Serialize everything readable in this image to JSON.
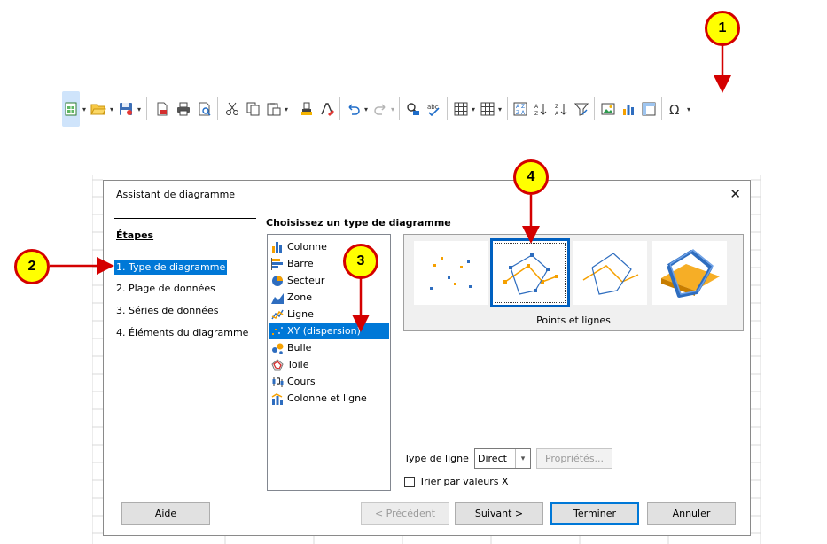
{
  "annotations": {
    "b1": "1",
    "b2": "2",
    "b3": "3",
    "b4": "4"
  },
  "toolbar": {
    "icons": [
      "new-spreadsheet-icon",
      "open-folder-icon",
      "save-icon",
      "export-pdf-icon",
      "print-icon",
      "print-preview-icon",
      "cut-icon",
      "copy-icon",
      "paste-icon",
      "clone-formatting-icon",
      "clear-formatting-icon",
      "undo-icon",
      "redo-icon",
      "find-replace-icon",
      "spelling-icon",
      "row-icon",
      "column-icon",
      "sort-icon",
      "sort-ascending-icon",
      "sort-descending-icon",
      "autofilter-icon",
      "insert-image-icon",
      "insert-chart-icon",
      "pivot-table-icon",
      "special-character-icon"
    ],
    "accent": "#1a73c8",
    "chart_icon_color": "#2e6dbf"
  },
  "dialog": {
    "title": "Assistant de diagramme",
    "close_glyph": "✕",
    "steps_heading": "Étapes",
    "steps": [
      {
        "label": "1. Type de diagramme",
        "active": true
      },
      {
        "label": "2. Plage de données",
        "active": false
      },
      {
        "label": "3. Séries de données",
        "active": false
      },
      {
        "label": "4. Éléments du diagramme",
        "active": false
      }
    ],
    "choose_heading": "Choisissez un type de diagramme",
    "chart_types": [
      {
        "label": "Colonne",
        "icon": "column-chart-icon",
        "selected": false
      },
      {
        "label": "Barre",
        "icon": "bar-chart-icon",
        "selected": false
      },
      {
        "label": "Secteur",
        "icon": "pie-chart-icon",
        "selected": false
      },
      {
        "label": "Zone",
        "icon": "area-chart-icon",
        "selected": false
      },
      {
        "label": "Ligne",
        "icon": "line-chart-icon",
        "selected": false
      },
      {
        "label": "XY (dispersion)",
        "icon": "xy-scatter-icon",
        "selected": true
      },
      {
        "label": "Bulle",
        "icon": "bubble-chart-icon",
        "selected": false
      },
      {
        "label": "Toile",
        "icon": "net-chart-icon",
        "selected": false
      },
      {
        "label": "Cours",
        "icon": "stock-chart-icon",
        "selected": false
      },
      {
        "label": "Colonne et ligne",
        "icon": "column-line-chart-icon",
        "selected": false
      }
    ],
    "variants": [
      {
        "name": "points-only-variant",
        "selected": false
      },
      {
        "name": "points-and-lines-variant",
        "selected": true
      },
      {
        "name": "lines-only-variant",
        "selected": false
      },
      {
        "name": "3d-lines-variant",
        "selected": false
      }
    ],
    "variant_label": "Points et lignes",
    "line_type_label": "Type de ligne",
    "line_type_value": "Direct",
    "properties_button": "Propriétés...",
    "sort_checkbox_label": "Trier par valeurs X",
    "buttons": {
      "help": "Aide",
      "back": "< Précédent",
      "next": "Suivant >",
      "finish": "Terminer",
      "cancel": "Annuler"
    }
  }
}
